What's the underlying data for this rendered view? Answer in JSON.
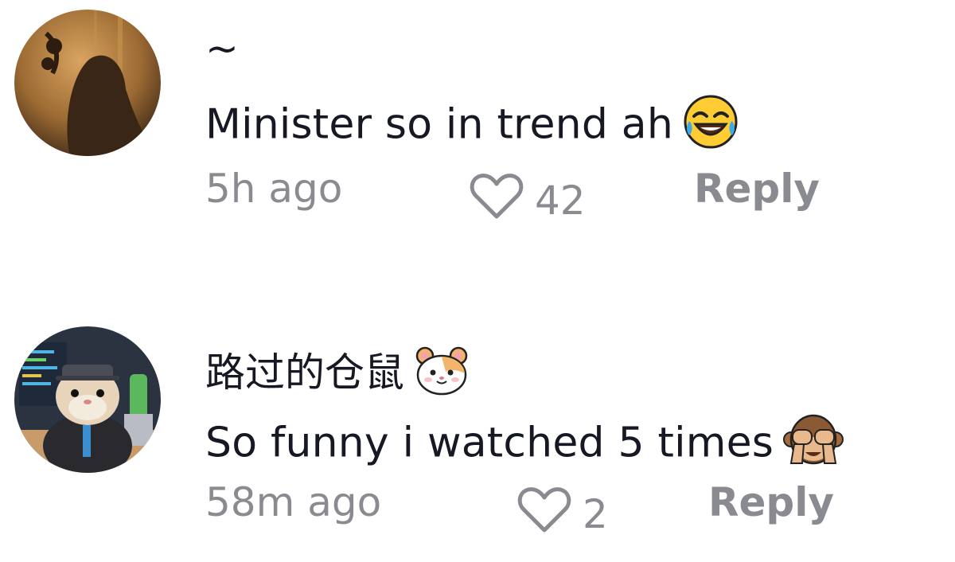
{
  "comments": [
    {
      "username": "~",
      "text": "Minister so in trend ah",
      "text_emoji": "face-with-tears-of-joy",
      "time": "5h ago",
      "likes": "42",
      "reply_label": "Reply",
      "avatar": "silhouette-photo-avatar"
    },
    {
      "username": "路过的仓鼠",
      "username_emoji": "hamster-face",
      "text": "So funny i watched 5 times",
      "text_emoji": "see-no-evil-monkey",
      "time": "58m ago",
      "likes": "2",
      "reply_label": "Reply",
      "avatar": "hamster-at-computer-avatar"
    }
  ],
  "colors": {
    "text": "#161823",
    "meta": "#8a8b91",
    "background": "#ffffff"
  }
}
